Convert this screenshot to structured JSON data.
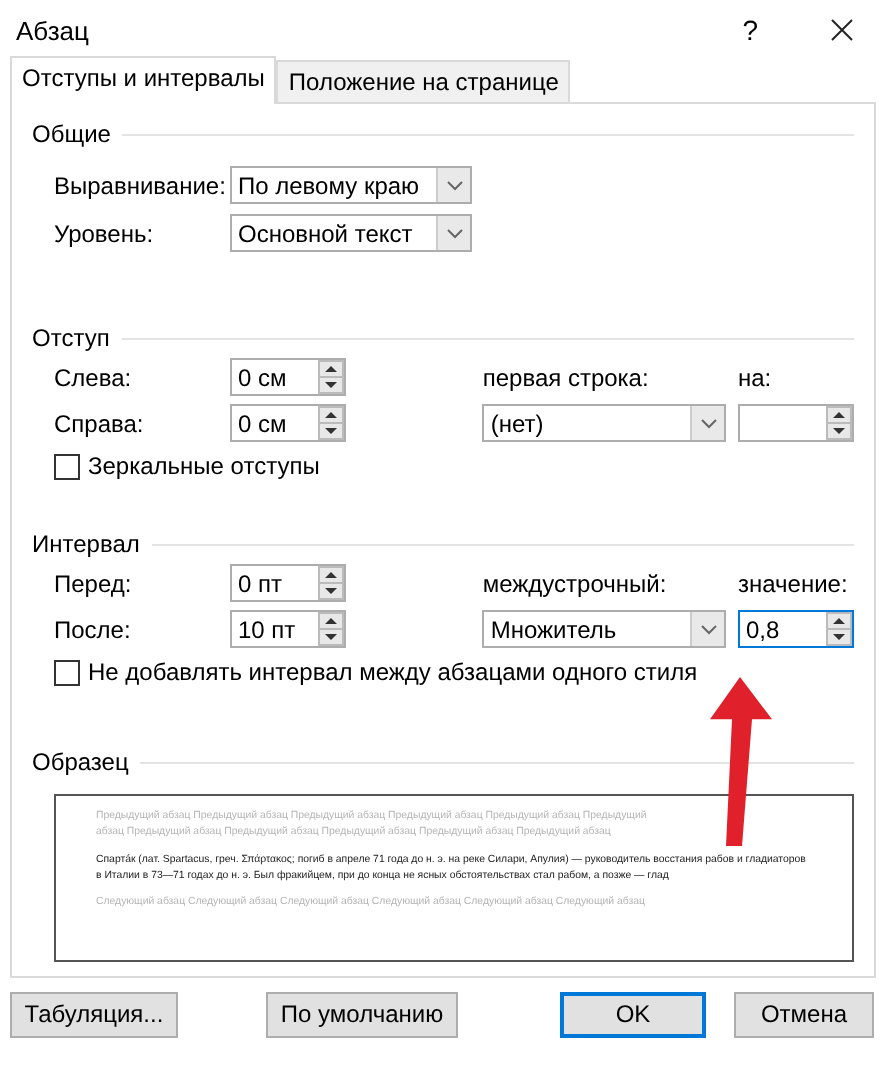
{
  "window": {
    "title": "Абзац",
    "help": "?"
  },
  "tabs": [
    {
      "label": "Отступы и интервалы",
      "selected": true
    },
    {
      "label": "Положение на странице",
      "selected": false
    }
  ],
  "general": {
    "title": "Общие",
    "rows": [
      {
        "label": "Выравнивание:",
        "value": "По левому краю"
      },
      {
        "label": "Уровень:",
        "value": "Основной текст"
      }
    ]
  },
  "indent": {
    "title": "Отступ",
    "fields": [
      {
        "label": "Слева:",
        "value": "0 см"
      },
      {
        "label": "Справа:",
        "value": "0 см"
      }
    ],
    "select": {
      "label": "первая строка:",
      "value": "(нет)"
    },
    "amount": {
      "label": "на:",
      "focused": false
    },
    "checkbox": {
      "label": "Зеркальные отступы",
      "checked": false
    }
  },
  "spacing": {
    "title": "Интервал",
    "fields": [
      {
        "label": "Перед:",
        "value": "0 пт"
      },
      {
        "label": "После:",
        "value": "10 пт"
      }
    ],
    "select": {
      "label": "междустрочный:",
      "value": "Множитель"
    },
    "amount": {
      "label": "значение:",
      "value": "0,8",
      "focused": true
    },
    "checkbox": {
      "label": "Не добавлять интервал между абзацами одного стиля",
      "checked": false
    }
  },
  "sample": {
    "title": "Образец",
    "previous": "Предыдущий абзац Предыдущий абзац Предыдущий абзац Предыдущий абзац Предыдущий абзац Предыдущий абзац Предыдущий абзац Предыдущий абзац Предыдущий абзац Предыдущий абзац Предыдущий абзац",
    "text": "Спартáк (лат. Spartacus, греч. Σπάρτακος; погиб в апреле 71 года до н. э. на реке Силари, Апулия) — руководитель восстания рабов и гладиаторов в Италии в 73—71 годах до н. э. Был фракийцем, при до конца не ясных обстоятельствах стал рабом, а позже — глад",
    "next": "Следующий абзац Следующий абзац Следующий абзац Следующий абзац Следующий абзац Следующий абзац"
  },
  "buttons": [
    {
      "label": "Табуляция...",
      "default": false
    },
    {
      "label": "По умолчанию",
      "default": false
    },
    {
      "label": "OK",
      "default": true
    },
    {
      "label": "Отмена",
      "default": false
    }
  ]
}
